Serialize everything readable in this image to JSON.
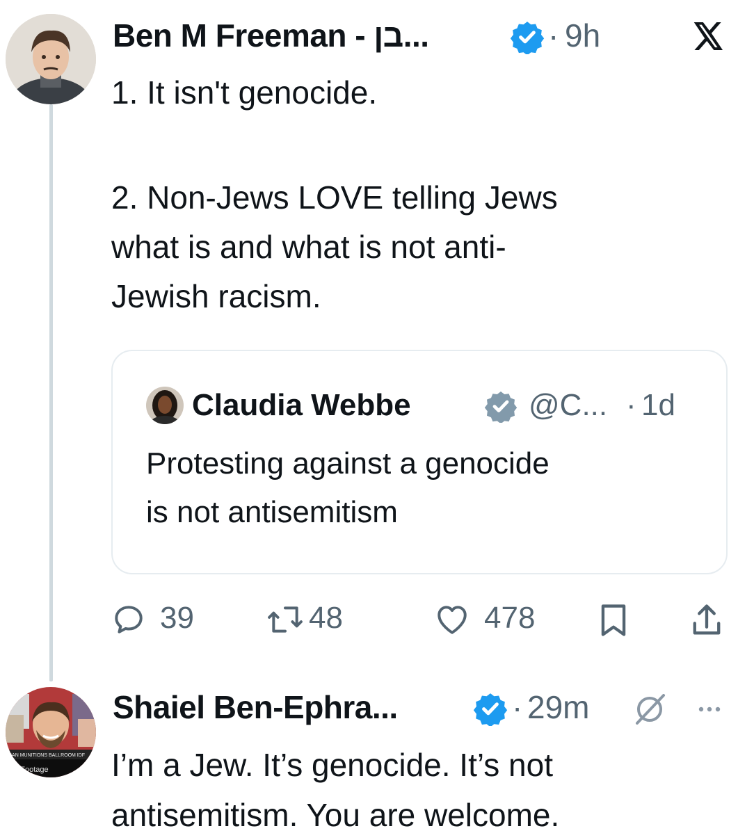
{
  "tweet": {
    "author_name": "Ben M Freeman - ‏בן...",
    "time": "9h",
    "platform_logo": "x-logo-icon",
    "lines": [
      "1. It isn't genocide.",
      "",
      "2. Non-Jews LOVE telling Jews",
      "what is and what is not anti-",
      "Jewish racism."
    ],
    "quote": {
      "author_name": "Claudia Webbe",
      "handle": "@C...",
      "time": "1d",
      "lines": [
        "Protesting against a genocide",
        "is not antisemitism"
      ]
    },
    "actions": {
      "replies": "39",
      "reposts": "48",
      "likes": "478"
    }
  },
  "reply": {
    "author_name": "Shaiel Ben-Ephra...",
    "time": "29m",
    "lines": [
      "I’m a Jew. It’s genocide. It’s not",
      "antisemitism. You are welcome."
    ]
  },
  "colors": {
    "verified": "#1d9bf0",
    "verified_gray": "#829aab",
    "text": "#0f1419",
    "muted": "#536471",
    "border": "#e6ecf0",
    "thread": "#cfd9de"
  },
  "icons": [
    "verified-badge-icon",
    "gray-verified-badge-icon",
    "x-logo-icon",
    "reply-icon",
    "repost-icon",
    "like-icon",
    "bookmark-icon",
    "share-icon",
    "muted-icon",
    "more-icon"
  ]
}
